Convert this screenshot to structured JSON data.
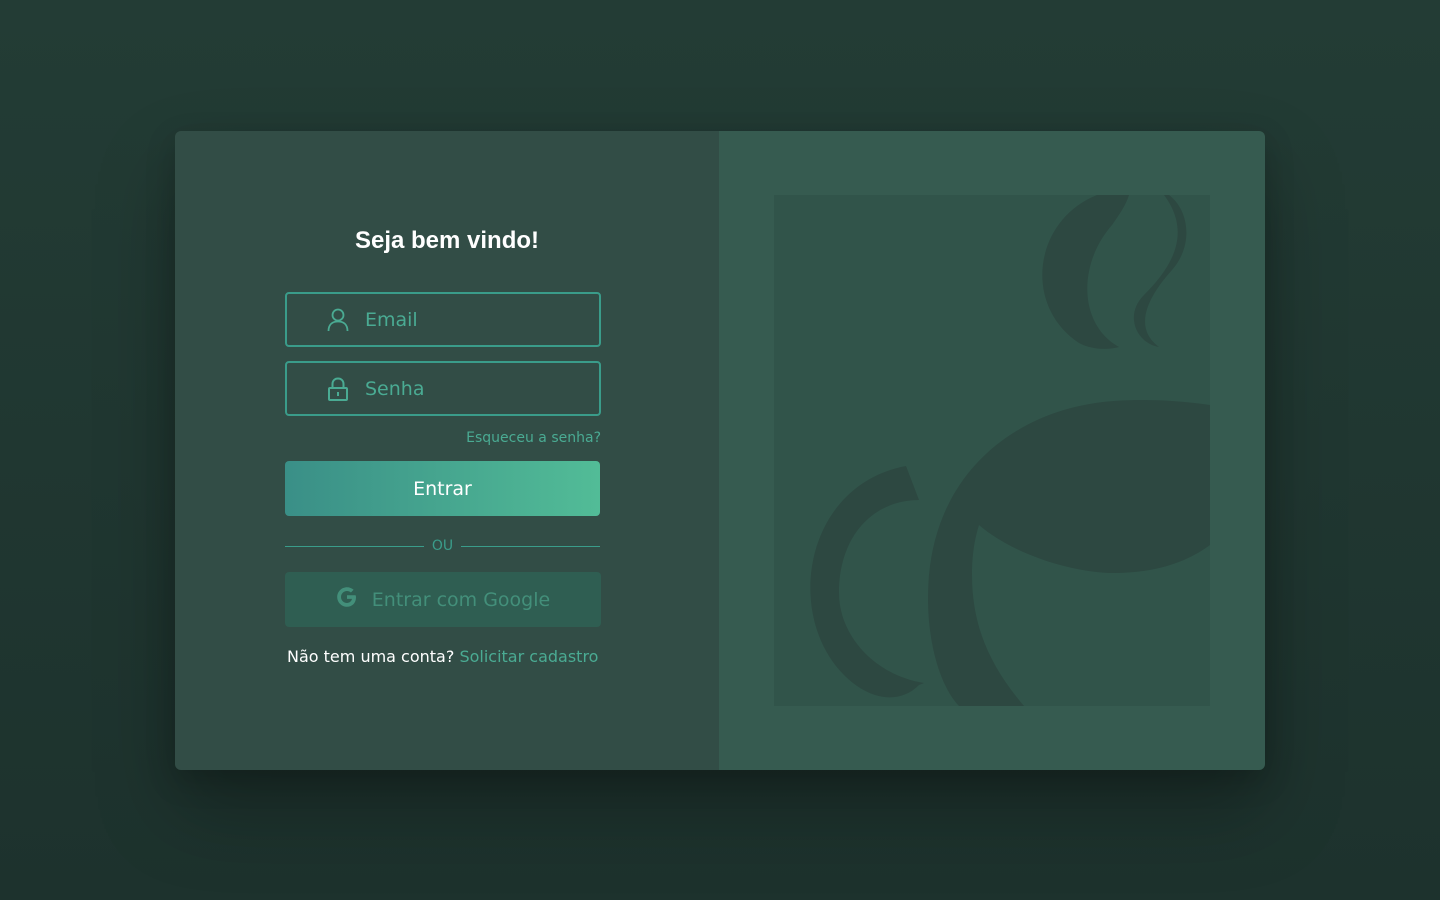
{
  "login": {
    "title": "Seja bem vindo!",
    "email_placeholder": "Email",
    "password_placeholder": "Senha",
    "forgot_password": "Esqueceu a senha?",
    "submit_label": "Entrar",
    "divider_label": "OU",
    "google_label": "Entrar com Google",
    "signup_prompt": "Não tem uma conta?",
    "signup_link": "Solicitar cadastro"
  },
  "colors": {
    "page_background": "#233c35",
    "left_panel": "#324d46",
    "right_panel": "#365b50",
    "accent": "#4aab93",
    "button_gradient_start": "#3a8f87",
    "button_gradient_end": "#52bc97"
  },
  "icons": {
    "email": "user-icon",
    "password": "lock-icon",
    "google": "google-g-icon",
    "illustration": "coffee-cup-logo"
  }
}
